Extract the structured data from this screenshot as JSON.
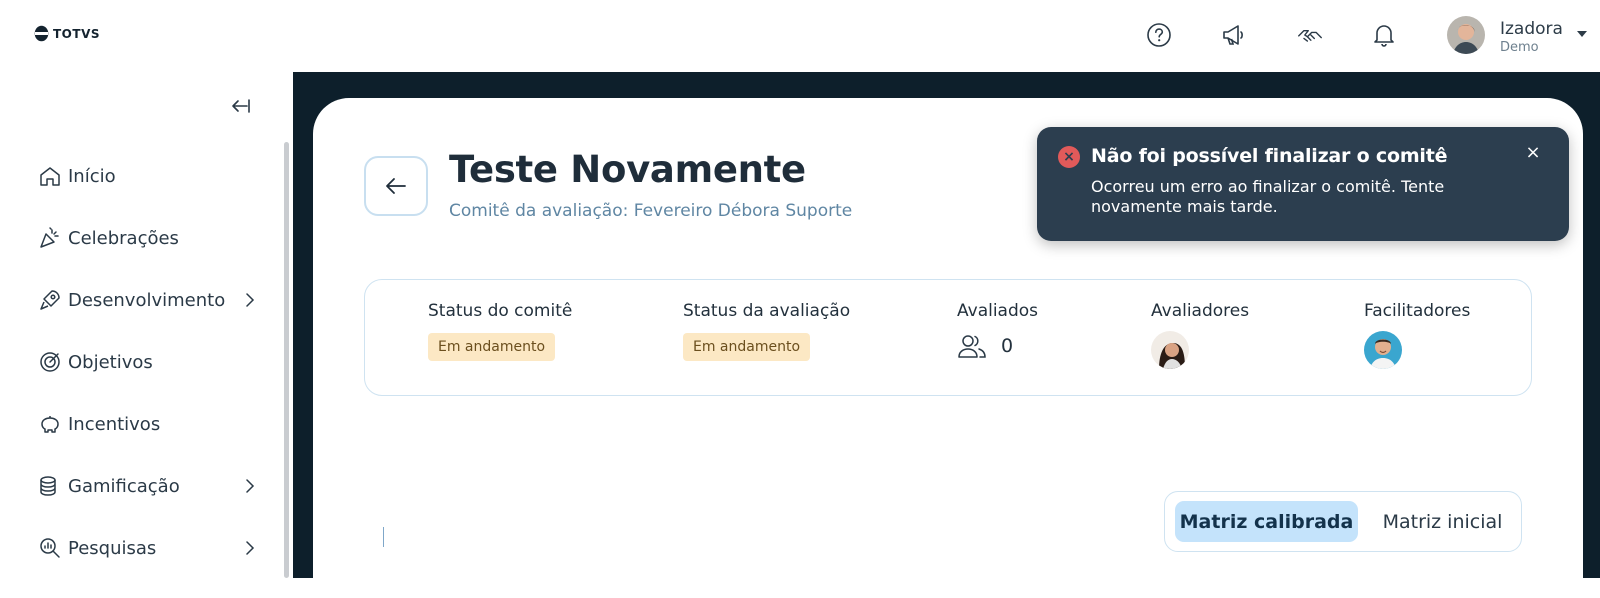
{
  "brand": {
    "logo_text": "TOTVS"
  },
  "header": {
    "icons": [
      "help-icon",
      "megaphone-icon",
      "handshake-icon",
      "bell-icon"
    ],
    "user": {
      "name": "Izadora",
      "role": "Demo"
    }
  },
  "sidebar": {
    "items": [
      {
        "label": "Início",
        "icon": "home-icon",
        "has_submenu": false
      },
      {
        "label": "Celebrações",
        "icon": "party-popper-icon",
        "has_submenu": false
      },
      {
        "label": "Desenvolvimento",
        "icon": "rocket-icon",
        "has_submenu": true
      },
      {
        "label": "Objetivos",
        "icon": "target-icon",
        "has_submenu": false
      },
      {
        "label": "Incentivos",
        "icon": "piggy-bank-icon",
        "has_submenu": false
      },
      {
        "label": "Gamificação",
        "icon": "coins-icon",
        "has_submenu": true
      },
      {
        "label": "Pesquisas",
        "icon": "search-chart-icon",
        "has_submenu": true
      }
    ]
  },
  "page": {
    "title": "Teste Novamente",
    "subtitle": "Comitê da avaliação: Fevereiro Débora Suporte"
  },
  "info": {
    "committee_status_label": "Status do comitê",
    "committee_status_value": "Em andamento",
    "evaluation_status_label": "Status da avaliação",
    "evaluation_status_value": "Em andamento",
    "evaluated_label": "Avaliados",
    "evaluated_count": "0",
    "evaluators_label": "Avaliadores",
    "facilitators_label": "Facilitadores"
  },
  "matrix_toggle": {
    "active": "Matriz calibrada",
    "inactive": "Matriz inicial"
  },
  "toast": {
    "title": "Não foi possível finalizar o comitê",
    "message": "Ocorreu um erro ao finalizar o comitê. Tente novamente mais tarde.",
    "close": "×",
    "error_glyph": "×"
  },
  "colors": {
    "main_bg": "#0d1f2b",
    "toast_bg": "#2c3e4f",
    "badge_bg": "#fce8c4",
    "toggle_active_bg": "#c4e3fb",
    "error": "#e15a5a"
  }
}
